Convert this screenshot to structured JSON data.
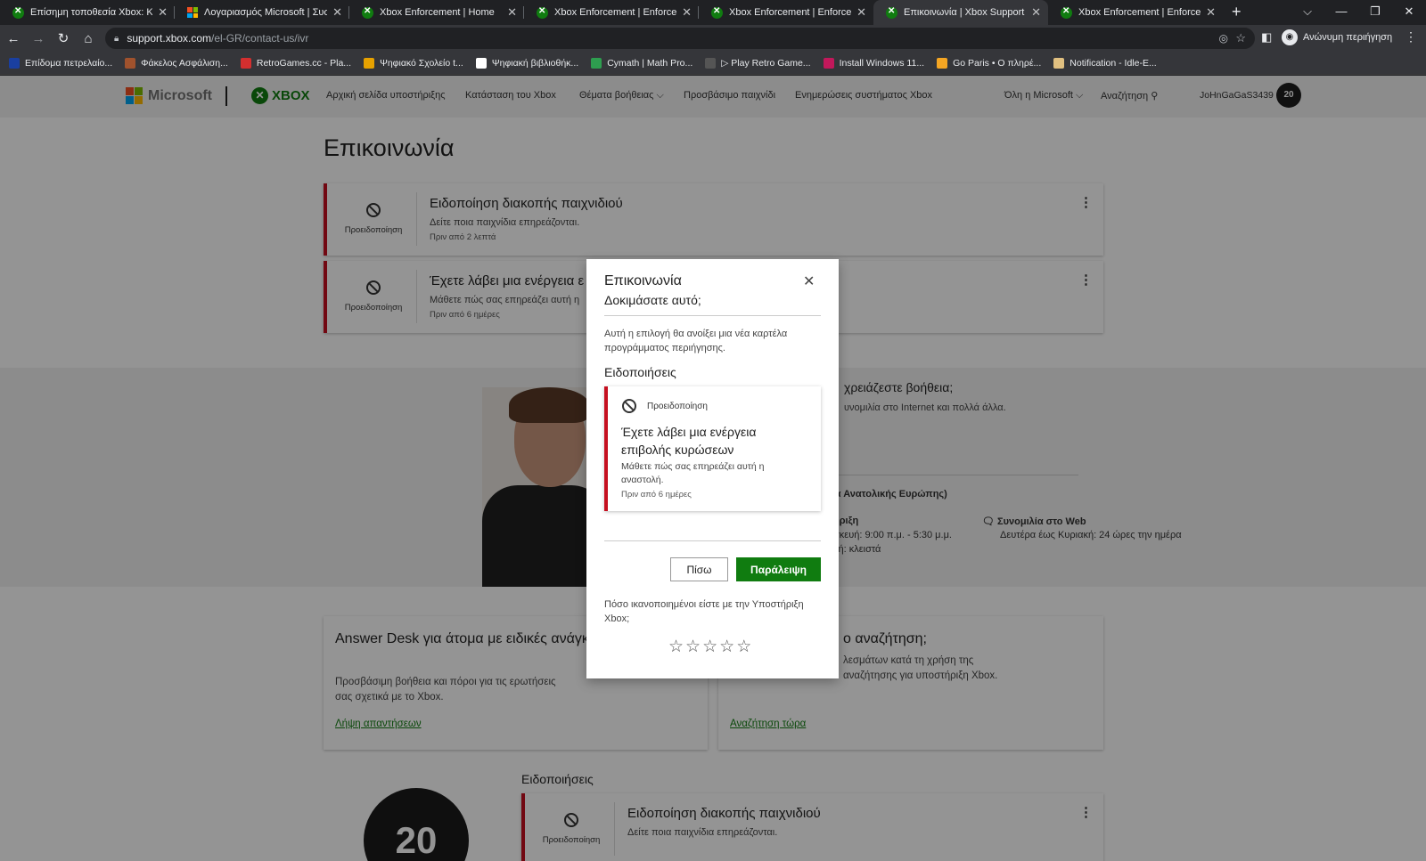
{
  "browser": {
    "tabs": [
      {
        "title": "Επίσημη τοποθεσία Xbox: Κονσ",
        "icon": "xbox-icon"
      },
      {
        "title": "Λογαριασμός Microsoft | Συσκε",
        "icon": "microsoft-icon"
      },
      {
        "title": "Xbox Enforcement | Home",
        "icon": "xbox-icon"
      },
      {
        "title": "Xbox Enforcement | Enforcemen",
        "icon": "xbox-icon"
      },
      {
        "title": "Xbox Enforcement | Enforcemen",
        "icon": "xbox-icon"
      },
      {
        "title": "Επικοινωνία | Xbox Support",
        "icon": "xbox-icon",
        "active": true
      },
      {
        "title": "Xbox Enforcement | Enforcemen",
        "icon": "xbox-icon"
      }
    ],
    "url_host": "support.xbox.com",
    "url_path": "/el-GR/contact-us/ivr",
    "incognito_label": "Ανώνυμη περιήγηση",
    "bookmarks": [
      {
        "label": "Επίδομα πετρελαίο...",
        "color": "#1a3fa0"
      },
      {
        "label": "Φάκελος Ασφάλιση...",
        "color": "#a0522d"
      },
      {
        "label": "RetroGames.cc - Pla...",
        "color": "#d32f2f"
      },
      {
        "label": "Ψηφιακό Σχολείο t...",
        "color": "#e6a100"
      },
      {
        "label": "Ψηφιακή βιβλιοθήκ...",
        "color": "#ffffff"
      },
      {
        "label": "Cymath | Math Pro...",
        "color": "#2e9e4f"
      },
      {
        "label": "▷ Play Retro Game...",
        "color": "#555555"
      },
      {
        "label": "Install Windows 11...",
        "color": "#c2185b"
      },
      {
        "label": "Go Paris • Ο πληρέ...",
        "color": "#f5a623"
      },
      {
        "label": "Notification - Idle-E...",
        "color": "#e0c080"
      }
    ]
  },
  "site": {
    "brand_microsoft": "Microsoft",
    "brand_xbox": "XBOX",
    "nav": [
      "Αρχική σελίδα υποστήριξης",
      "Κατάσταση του Xbox",
      "Θέματα βοήθειας ⌵",
      "Προσβάσιμο παιχνίδι",
      "Ενημερώσεις συστήματος Xbox"
    ],
    "all_microsoft": "Όλη η Microsoft ⌵",
    "search": "Αναζήτηση ⚲",
    "username": "JoHnGaGaS3439",
    "avatar_text": "20",
    "accent": "#107c10"
  },
  "page": {
    "title": "Επικοινωνία",
    "alerts": [
      {
        "label": "Προειδοποίηση",
        "title": "Ειδοποίηση διακοπής παιχνιδιού",
        "desc": "Δείτε ποια παιχνίδια επηρεάζονται.",
        "time": "Πριν από 2 λεπτά"
      },
      {
        "label": "Προειδοποίηση",
        "title": "Έχετε λάβει μια ενέργεια ε",
        "desc": "Μάθετε πώς σας επηρεάζει αυτή η",
        "time": "Πριν από 6 ημέρες"
      }
    ],
    "help": {
      "question": "χρειάζεστε βοήθεια;",
      "sub": "υνομιλία στο Internet και πολλά άλλα.",
      "region": "ρα Ανατολικής Ευρώπης)",
      "phone_title": "ήριξη",
      "phone_hours": "σκευή: 9:00 π.μ. - 5:30 μ.μ.",
      "phone_closed": "κή: κλειστά",
      "chat_title": "Συνομιλία στο Web",
      "chat_hours": "Δευτέρα έως Κυριακή: 24 ώρες την ημέρα"
    },
    "cards": [
      {
        "title": "Answer Desk για άτομα με ειδικές ανάγκες",
        "desc": "Προσβάσιμη βοήθεια και πόροι για τις ερωτήσεις σας σχετικά με το Xbox.",
        "link": "Λήψη απαντήσεων"
      },
      {
        "title": "ο αναζήτηση;",
        "desc": "λεσμάτων κατά τη χρήση της αναζήτησης για υποστήριξη Xbox.",
        "link": "Αναζήτηση τώρα"
      }
    ],
    "notifications_heading": "Ειδοποιήσεις",
    "bottom_alert": {
      "label": "Προειδοποίηση",
      "title": "Ειδοποίηση διακοπής παιχνιδιού",
      "desc": "Δείτε ποια παιχνίδια επηρεάζονται."
    }
  },
  "modal": {
    "title": "Επικοινωνία",
    "subtitle": "Δοκιμάσατε αυτό;",
    "text": "Αυτή η επιλογή θα ανοίξει μια νέα καρτέλα προγράμματος περιήγησης.",
    "notifications_heading": "Ειδοποιήσεις",
    "card": {
      "label": "Προειδοποίηση",
      "title": "Έχετε λάβει μια ενέργεια επιβολής κυρώσεων",
      "desc": "Μάθετε πώς σας επηρεάζει αυτή η αναστολή.",
      "time": "Πριν από 6 ημέρες"
    },
    "back_label": "Πίσω",
    "skip_label": "Παράλειψη",
    "rating_question": "Πόσο ικανοποιημένοι είστε με την Υποστήριξη Xbox;",
    "rating": 0,
    "rating_max": 5,
    "alert_color": "#c50f1f"
  }
}
